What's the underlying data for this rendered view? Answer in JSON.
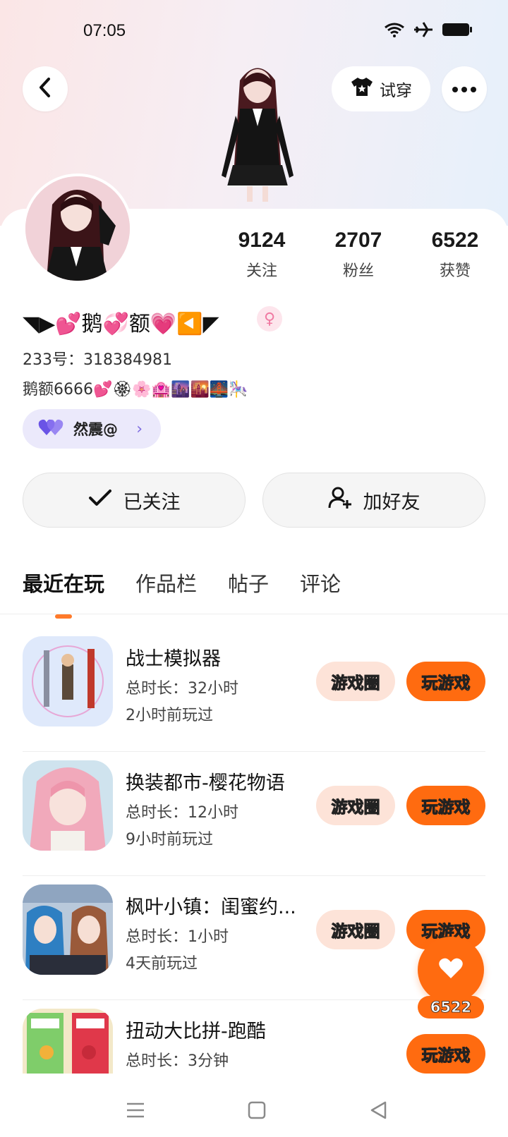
{
  "status_bar": {
    "time": "07:05",
    "icons": [
      "wifi-icon",
      "airplane-mode-icon",
      "battery-icon"
    ]
  },
  "header": {
    "try_on_label": "试穿",
    "try_on_icon": "tshirt-icon",
    "back_icon": "chevron-left-icon",
    "more_icon": "more-dots-icon"
  },
  "profile": {
    "stats": [
      {
        "value": "9124",
        "label": "关注"
      },
      {
        "value": "2707",
        "label": "粉丝"
      },
      {
        "value": "6522",
        "label": "获赞"
      }
    ],
    "nickname": "◥▶💕鹅💞额💗◀️◤",
    "gender_symbol": "♀",
    "uid_text": "233号：318384981",
    "bio": "鹅额6666💕🏵🌸🏩🌆🌇🌉🎠",
    "cp": {
      "name": "然震@",
      "icon": "double-heart-icon",
      "chevron": "›"
    }
  },
  "actions": {
    "follow_label": "已关注",
    "add_friend_label": "加好友"
  },
  "tabs": [
    {
      "label": "最近在玩",
      "active": true
    },
    {
      "label": "作品栏",
      "active": false
    },
    {
      "label": "帖子",
      "active": false
    },
    {
      "label": "评论",
      "active": false
    }
  ],
  "games": [
    {
      "title": "战士模拟器",
      "duration": "总时长：32小时",
      "last_played": "2小时前玩过",
      "circle_label": "游戏圈",
      "play_label": "玩游戏"
    },
    {
      "title": "换装都市-樱花物语",
      "duration": "总时长：12小时",
      "last_played": "9小时前玩过",
      "circle_label": "游戏圈",
      "play_label": "玩游戏"
    },
    {
      "title": "枫叶小镇：闺蜜约...",
      "duration": "总时长：1小时",
      "last_played": "4天前玩过",
      "circle_label": "游戏圈",
      "play_label": "玩游戏"
    },
    {
      "title": "扭动大比拼-跑酷",
      "duration": "总时长：3分钟",
      "last_played": "",
      "circle_label": "",
      "play_label": "玩游戏"
    }
  ],
  "like_fab": {
    "count": "6522",
    "icon": "heart-icon"
  },
  "colors": {
    "accent": "#ff6b10",
    "circle_pill_bg": "#fde3d8",
    "cp_chip_bg": "#ebe9fb",
    "tab_indicator": "#ff7a2a"
  },
  "nav": {
    "icons": [
      "menu-icon",
      "home-square-icon",
      "back-triangle-icon"
    ]
  }
}
